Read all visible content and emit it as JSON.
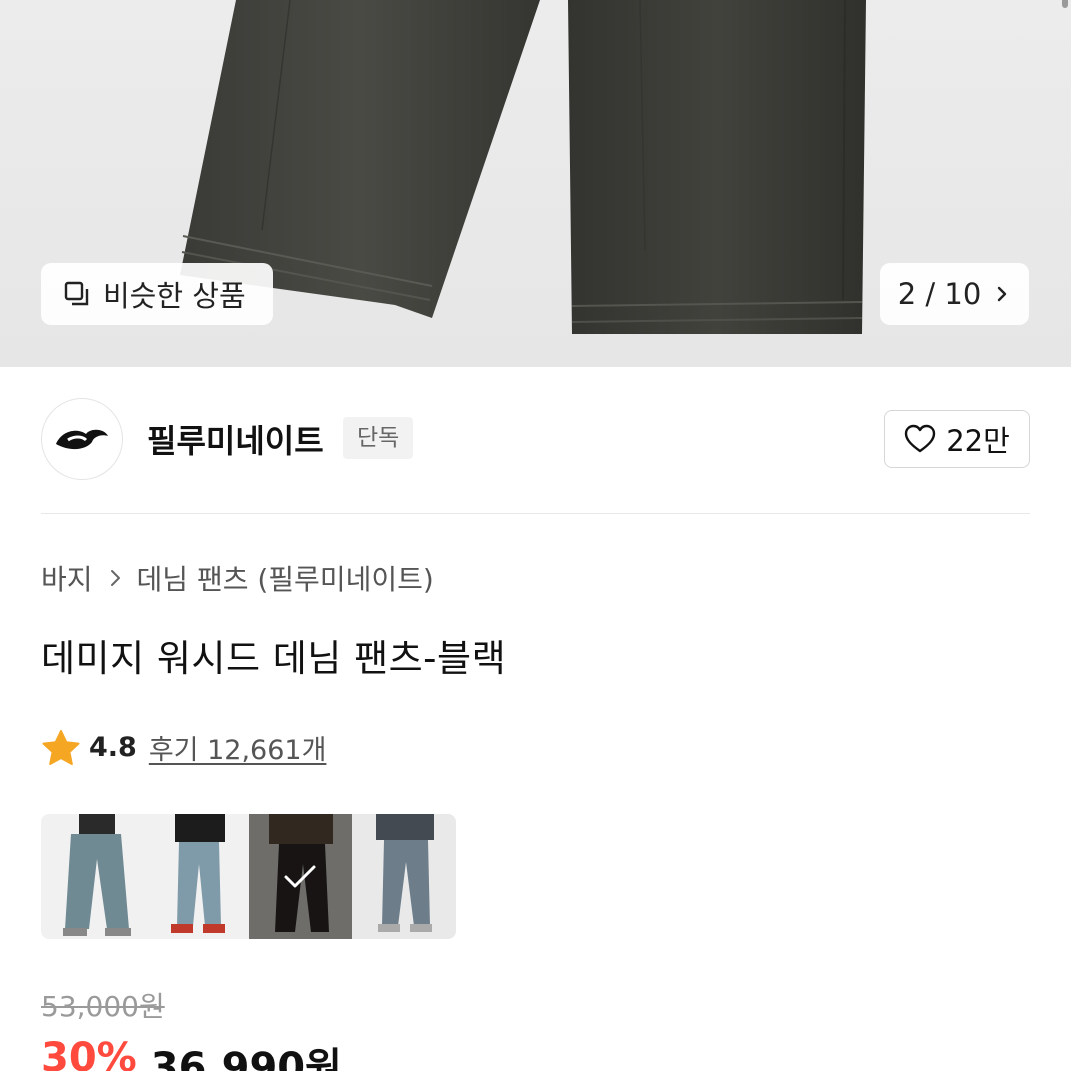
{
  "hero": {
    "similar_label": "비슷한 상품",
    "counter": "2 / 10"
  },
  "brand": {
    "name": "필루미네이트",
    "badge": "단독",
    "likes": "22만"
  },
  "breadcrumb": [
    "바지",
    "데님 팬츠 (필루미네이트)"
  ],
  "product": {
    "title": "데미지 워시드 데님 팬츠-블랙"
  },
  "rating": {
    "score": "4.8",
    "reviews": "후기 12,661개"
  },
  "swatches": {
    "selected_index": 2,
    "colors": [
      "#6f8a93",
      "#7f9aa9",
      "#2a2624",
      "#6e7d8a"
    ]
  },
  "price": {
    "original": "53,000원",
    "discount": "30%",
    "final": "36,990원"
  },
  "colors": {
    "discount_red": "#ff4a3d",
    "star_gold": "#f5a623"
  }
}
